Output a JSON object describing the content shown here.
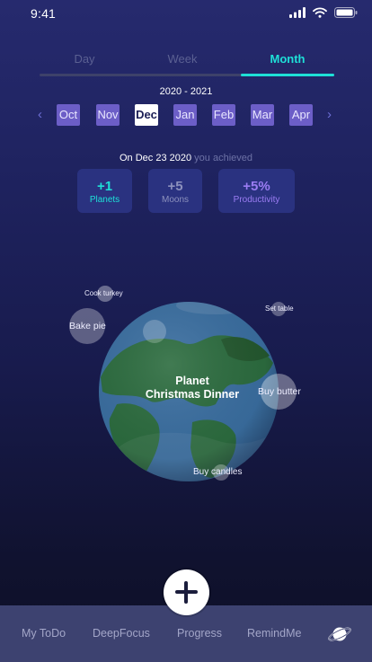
{
  "status": {
    "time": "9:41"
  },
  "tabs": [
    {
      "label": "Day",
      "active": false
    },
    {
      "label": "Week",
      "active": false
    },
    {
      "label": "Month",
      "active": true
    }
  ],
  "calendar": {
    "year_range": "2020 - 2021",
    "months": [
      "Oct",
      "Nov",
      "Dec",
      "Jan",
      "Feb",
      "Mar",
      "Apr"
    ],
    "selected": "Dec"
  },
  "achievement": {
    "date_text": "On Dec 23 2020",
    "suffix": "you achieved",
    "stats": [
      {
        "value": "+1",
        "label": "Planets",
        "color": "#1ee0d7"
      },
      {
        "value": "+5",
        "label": "Moons",
        "color": "#8c91bd"
      },
      {
        "value": "+5%",
        "label": "Productivity",
        "color": "#9a7cf2"
      }
    ]
  },
  "planet": {
    "line1": "Planet",
    "line2": "Christmas Dinner",
    "moons": [
      "Cook turkey",
      "Bake pie",
      "Set table",
      "Buy butter",
      "Buy candles"
    ]
  },
  "nav": {
    "items": [
      "My ToDo",
      "DeepFocus",
      "Progress",
      "RemindMe"
    ],
    "planet_icon": "planet-icon"
  },
  "colors": {
    "accent": "#1ee0d7",
    "month_chip": "#6c5ec7",
    "nav_bg": "#3d4270",
    "stat_bg": "#2a3280"
  }
}
